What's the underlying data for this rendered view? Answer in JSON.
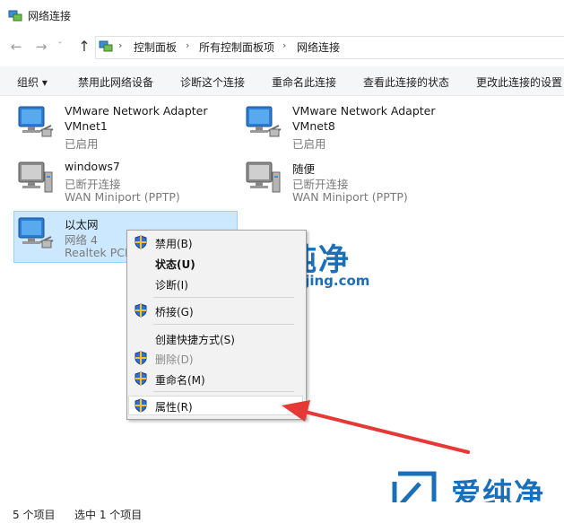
{
  "window": {
    "title": "网络连接"
  },
  "address": {
    "crumbs": [
      "控制面板",
      "所有控制面板项",
      "网络连接"
    ]
  },
  "nav_icons": {
    "back": "←",
    "forward": "→",
    "dropdown": "˅",
    "up": "↑",
    "crumb_sep": "›"
  },
  "toolbar": {
    "organize": "组织 ▾",
    "disable": "禁用此网络设备",
    "diagnose": "诊断这个连接",
    "rename": "重命名此连接",
    "status": "查看此连接的状态",
    "change": "更改此连接的设置"
  },
  "connections": [
    {
      "name": "VMware Network Adapter",
      "name2": "VMnet1",
      "status": "已启用"
    },
    {
      "name": "VMware Network Adapter",
      "name2": "VMnet8",
      "status": "已启用"
    },
    {
      "name": "windows7",
      "status": "已断开连接",
      "device": "WAN Miniport (PPTP)"
    },
    {
      "name": "随便",
      "status": "已断开连接",
      "device": "WAN Miniport (PPTP)"
    },
    {
      "name": "以太网",
      "status": "网络 4",
      "device": "Realtek PCI"
    }
  ],
  "context_menu": {
    "items": [
      "禁用(B)",
      "状态(U)",
      "诊断(I)",
      "桥接(G)",
      "创建快捷方式(S)",
      "删除(D)",
      "重命名(M)",
      "属性(R)"
    ]
  },
  "statusbar": {
    "count": "5 个项目",
    "selected": "选中 1 个项目"
  },
  "watermark": {
    "brand": "爱纯净",
    "url": "aichunjing.com"
  },
  "colors": {
    "accent": "#1b6fb8",
    "selection": "#cce8ff",
    "arrow": "#e53935"
  }
}
